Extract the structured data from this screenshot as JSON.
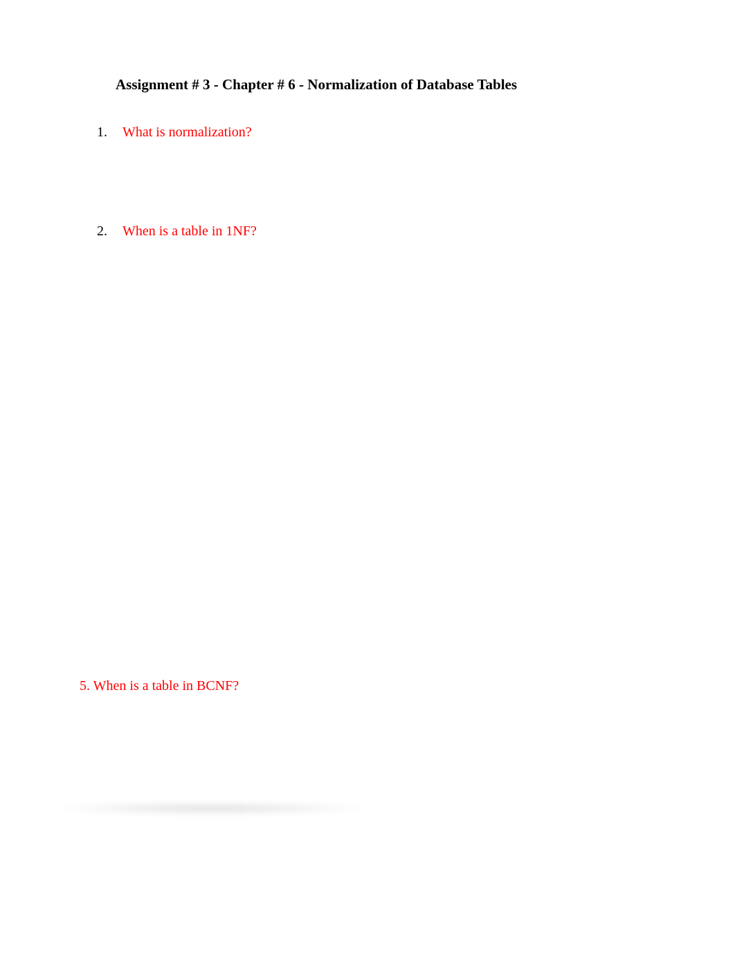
{
  "title": "Assignment # 3 - Chapter # 6 - Normalization of Database Tables",
  "items": [
    {
      "num": "1.",
      "text": "What is normalization?"
    },
    {
      "num": "2.",
      "text": "When is a table in 1NF?"
    }
  ],
  "q5": "5. When is a table in BCNF?"
}
